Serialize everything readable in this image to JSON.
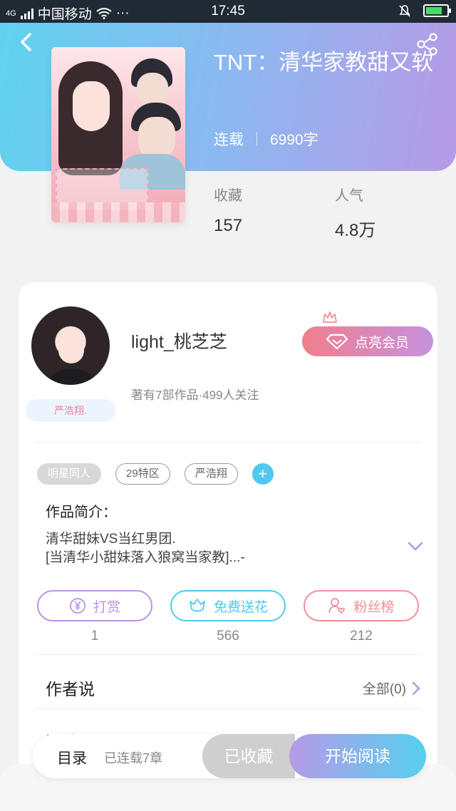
{
  "status_bar": {
    "carrier_prefix": "4G",
    "carrier": "中国移动",
    "wifi_icon": "wifi-icon",
    "more": "···",
    "time": "17:45"
  },
  "book": {
    "title": "TNT：清华家教甜又软",
    "status": "连载",
    "word_count": "6990字",
    "favorites_label": "收藏",
    "favorites_value": "157",
    "popularity_label": "人气",
    "popularity_value": "4.8万"
  },
  "author": {
    "name": "light_桃芝芝",
    "badge": "严浩翔.",
    "meta": "著有7部作品·499人关注",
    "vip_button": "点亮会员"
  },
  "tags": [
    "明星同人",
    "29特区",
    "严浩翔"
  ],
  "intro": {
    "label": "作品简介：",
    "line1": "清华甜妹VS当红男团.",
    "line2": "[当清华小甜妹落入狼窝当家教]...-"
  },
  "actions": [
    {
      "label": "打赏",
      "count": "1",
      "color": "#b994e2"
    },
    {
      "label": "免费送花",
      "count": "566",
      "color": "#4fc9ee"
    },
    {
      "label": "粉丝榜",
      "count": "212",
      "color": "#f08f9a"
    }
  ],
  "author_says": {
    "label": "作者说",
    "all": "全部(0)"
  },
  "comments": {
    "label": "评论"
  },
  "bottom_bar": {
    "toc": "目录",
    "chapters": "已连载7章",
    "favorited": "已收藏",
    "read": "开始阅读"
  },
  "colors": {
    "accent_blue": "#4fc9ee",
    "accent_purple": "#b994e2",
    "accent_pink": "#f08f9a"
  }
}
